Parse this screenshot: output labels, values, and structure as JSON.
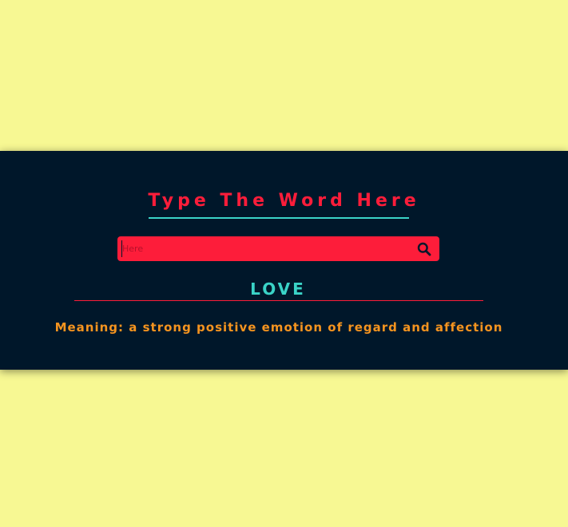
{
  "title": "Type The Word Here",
  "search": {
    "placeholder": "Here",
    "value": "",
    "button_icon": "search-icon"
  },
  "result": {
    "word": "LOVE",
    "meaning": "Meaning: a strong positive emotion of regard and affection"
  },
  "colors": {
    "background": "#f7f893",
    "panel": "#00172a",
    "accent_red": "#fd1d3a",
    "accent_teal": "#3ad3c7",
    "meaning_orange": "#f5941f"
  }
}
